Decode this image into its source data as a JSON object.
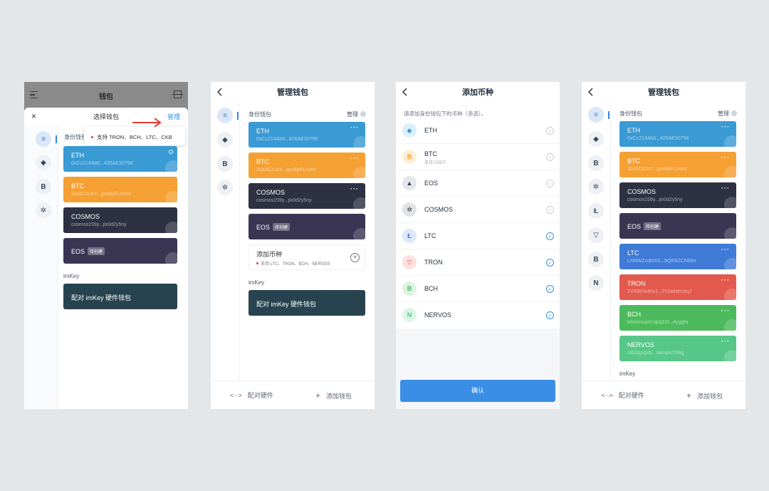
{
  "p1": {
    "top_title": "钱包",
    "sheet_title": "选择钱包",
    "manage": "管理",
    "tooltip": "支持 TRON、BCH、LTC、CKB",
    "section": "身份钱包",
    "imkey_section": "imKey",
    "pair_label": "配对 imKey 硬件钱包",
    "cards": [
      {
        "name": "ETH",
        "addr": "0xCc214Ab6...426AE30798"
      },
      {
        "name": "BTC",
        "addr": "31a3CXJsY...gvx8pFLmmx"
      },
      {
        "name": "COSMOS",
        "addr": "cosmos159y...jlx0d2y5ny"
      },
      {
        "name": "EOS",
        "tag": "待创建"
      }
    ]
  },
  "p2": {
    "title": "管理钱包",
    "section": "身份钱包",
    "manage": "管理",
    "cards": [
      {
        "name": "ETH",
        "addr": "0xCc214Ab6...426AE30798"
      },
      {
        "name": "BTC",
        "addr": "31a3CXJsY...gvx8pFLmmx"
      },
      {
        "name": "COSMOS",
        "addr": "cosmos159y...jlx0d2y5ny"
      },
      {
        "name": "EOS",
        "tag": "待创建"
      }
    ],
    "add_coin_title": "添加币种",
    "add_coin_sub": "支持 LTC、TRON、BCH、NERVOS",
    "imkey_section": "imKey",
    "pair_label": "配对 imKey 硬件钱包",
    "footer_left": "配对硬件",
    "footer_right": "添加钱包"
  },
  "p3": {
    "title": "添加币种",
    "subtitle": "请添加身份钱包下的币种（多选）。",
    "coins": [
      {
        "name": "ETH",
        "sub": ""
      },
      {
        "name": "BTC",
        "sub": "支持 USDT"
      },
      {
        "name": "EOS",
        "sub": ""
      },
      {
        "name": "COSMOS",
        "sub": ""
      },
      {
        "name": "LTC",
        "sub": ""
      },
      {
        "name": "TRON",
        "sub": ""
      },
      {
        "name": "BCH",
        "sub": ""
      },
      {
        "name": "NERVOS",
        "sub": ""
      }
    ],
    "confirm": "确认"
  },
  "p4": {
    "title": "管理钱包",
    "section": "身份钱包",
    "manage": "管理",
    "cards": [
      {
        "name": "ETH",
        "addr": "0xCc214Ab6...426AE30798"
      },
      {
        "name": "BTC",
        "addr": "31a3CXJsY...gvx8pFLmmx"
      },
      {
        "name": "COSMOS",
        "addr": "cosmos159y...jlx0d2y5ny"
      },
      {
        "name": "EOS",
        "tag": "待创建"
      },
      {
        "name": "LTC",
        "addr": "LhMWZxdMA5...6QR8ZCN56e"
      },
      {
        "name": "TRON",
        "addr": "TVXW7e4hv1...PrSwNhUmj7"
      },
      {
        "name": "BCH",
        "addr": "bitcoincash:qpq22t...4yggfa"
      },
      {
        "name": "NERVOS",
        "addr": "ckb1qyqvlu...8anqm708qj"
      }
    ],
    "imkey_section": "imKey",
    "footer_left": "配对硬件",
    "footer_right": "添加钱包"
  },
  "colors": {
    "eth": "#3a9ad3",
    "btc": "#f5a033",
    "cosmos": "#2d3142",
    "eos": "#3a3553",
    "ltc": "#3f7bd6",
    "tron": "#e25a4e",
    "bch": "#4cba5c",
    "nervos": "#56c786",
    "pair": "#27434f",
    "accent": "#3a8ee6",
    "arrow": "#e53935"
  }
}
